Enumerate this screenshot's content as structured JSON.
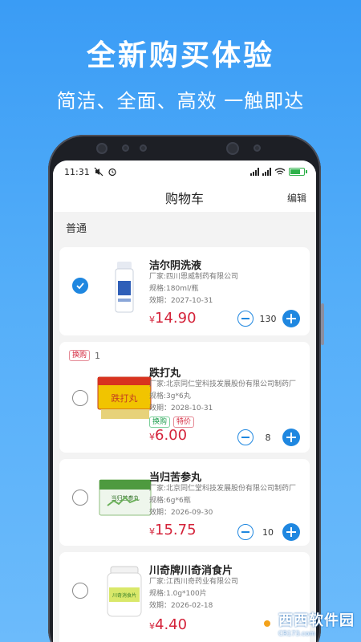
{
  "promo": {
    "title": "全新购买体验",
    "subtitle": "简洁、全面、高效 一触即达"
  },
  "status": {
    "time": "11:31"
  },
  "nav": {
    "title": "购物车",
    "edit": "编辑"
  },
  "section": "普通",
  "labels": {
    "exchange_count": "1"
  },
  "items": [
    {
      "name": "洁尔阴洗液",
      "manufacturer": "厂家:四川恩威制药有限公司",
      "spec": "规格:180ml/瓶",
      "expiry": "效期：2027-10-31",
      "currency": "¥",
      "price": "14.90",
      "qty": "130",
      "checked": true,
      "exchange_tag": "",
      "tags": []
    },
    {
      "name": "跌打丸",
      "manufacturer": "厂家:北京同仁堂科技发展股份有限公司制药厂",
      "spec": "规格:3g*6丸",
      "expiry": "效期：2028-10-31",
      "currency": "¥",
      "price": "6.00",
      "qty": "8",
      "checked": false,
      "exchange_tag": "换购",
      "tags": [
        "换购",
        "特价"
      ]
    },
    {
      "name": "当归苦参丸",
      "manufacturer": "厂家:北京同仁堂科技发展股份有限公司制药厂",
      "spec": "规格:6g*6瓶",
      "expiry": "效期：2026-09-30",
      "currency": "¥",
      "price": "15.75",
      "qty": "10",
      "checked": false,
      "exchange_tag": "",
      "tags": []
    },
    {
      "name": "川奇牌川奇消食片",
      "manufacturer": "厂家:江西川奇药业有限公司",
      "spec": "规格:1.0g*100片",
      "expiry": "效期：2026-02-18",
      "currency": "¥",
      "price": "4.40",
      "qty": "",
      "checked": false,
      "exchange_tag": "",
      "tags": []
    }
  ],
  "product_art": {
    "dadawan_box": "跌打丸",
    "dangui_box": "当归苦参丸",
    "chuanqi_label": "川奇消食片"
  },
  "watermark": {
    "main": "西西软件园",
    "sub": "CR173.com"
  },
  "colors": {
    "accent": "#1f87e0",
    "price": "#d4233a",
    "background": "#4aa7f7"
  }
}
